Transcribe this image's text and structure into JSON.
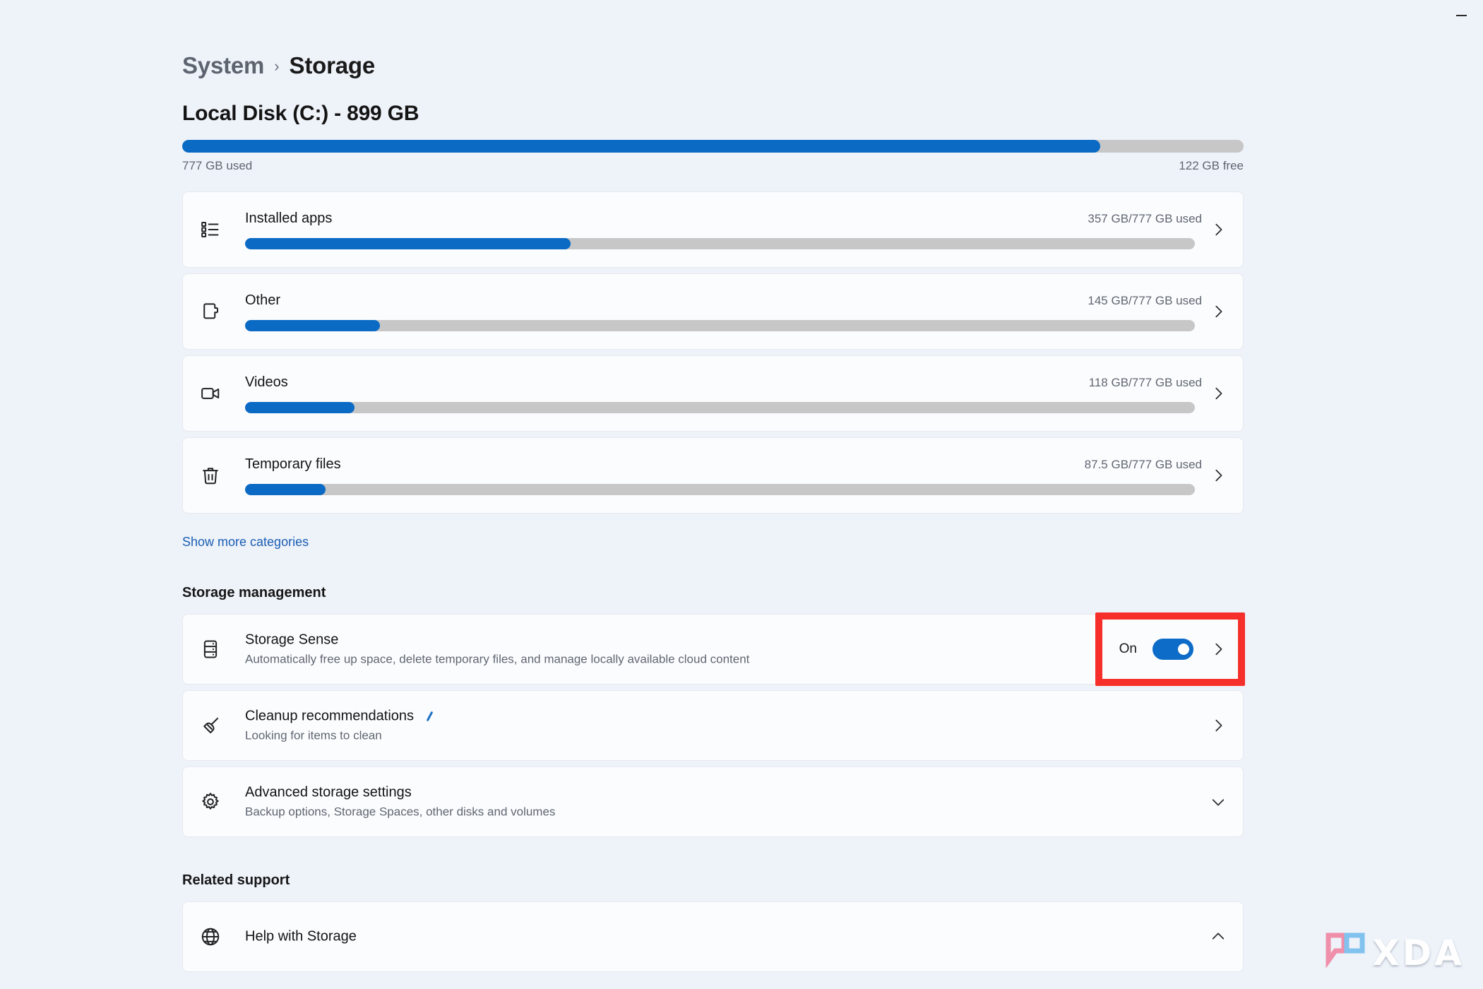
{
  "window": {
    "minimize_label": "Minimize"
  },
  "breadcrumb": {
    "parent": "System",
    "separator": "›",
    "current": "Storage"
  },
  "disk": {
    "title": "Local Disk (C:) - 899 GB",
    "used_label": "777 GB used",
    "free_label": "122 GB free",
    "used_percent": 86.5
  },
  "categories": [
    {
      "icon": "list-icon",
      "label": "Installed apps",
      "usage": "357 GB/777 GB used",
      "percent": 34.3,
      "chevron": "chevron-right-icon"
    },
    {
      "icon": "documents-icon",
      "label": "Other",
      "usage": "145 GB/777 GB used",
      "percent": 14.2,
      "chevron": "chevron-right-icon"
    },
    {
      "icon": "video-camera-icon",
      "label": "Videos",
      "usage": "118 GB/777 GB used",
      "percent": 11.5,
      "chevron": "chevron-right-icon"
    },
    {
      "icon": "trash-icon",
      "label": "Temporary files",
      "usage": "87.5 GB/777 GB used",
      "percent": 8.5,
      "chevron": "chevron-right-icon"
    }
  ],
  "show_more_link": "Show more categories",
  "storage_management": {
    "heading": "Storage management",
    "items": [
      {
        "icon": "drive-stack-icon",
        "title": "Storage Sense",
        "subtitle": "Automatically free up space, delete temporary files, and manage locally available cloud content",
        "toggle_state": "On",
        "toggle_on": true,
        "chevron": "chevron-right-icon",
        "highlighted": true
      },
      {
        "icon": "broom-icon",
        "title": "Cleanup recommendations",
        "subtitle": "Looking for items to clean",
        "chevron": "chevron-right-icon",
        "busy": true
      },
      {
        "icon": "gear-icon",
        "title": "Advanced storage settings",
        "subtitle": "Backup options, Storage Spaces, other disks and volumes",
        "chevron": "chevron-down-icon"
      }
    ]
  },
  "related_support": {
    "heading": "Related support",
    "items": [
      {
        "icon": "globe-icon",
        "title": "Help with Storage",
        "chevron": "chevron-up-icon"
      }
    ]
  },
  "watermark": {
    "text": "XDA"
  },
  "colors": {
    "accent_blue": "#0a6ac4",
    "toggle_blue": "#0d6cc8",
    "track_gray": "#c7c7c7",
    "link_blue": "#1a5fb4",
    "highlight_red": "#f62f2a",
    "page_bg": "#eef2f9",
    "card_bg": "#fbfcfe"
  }
}
